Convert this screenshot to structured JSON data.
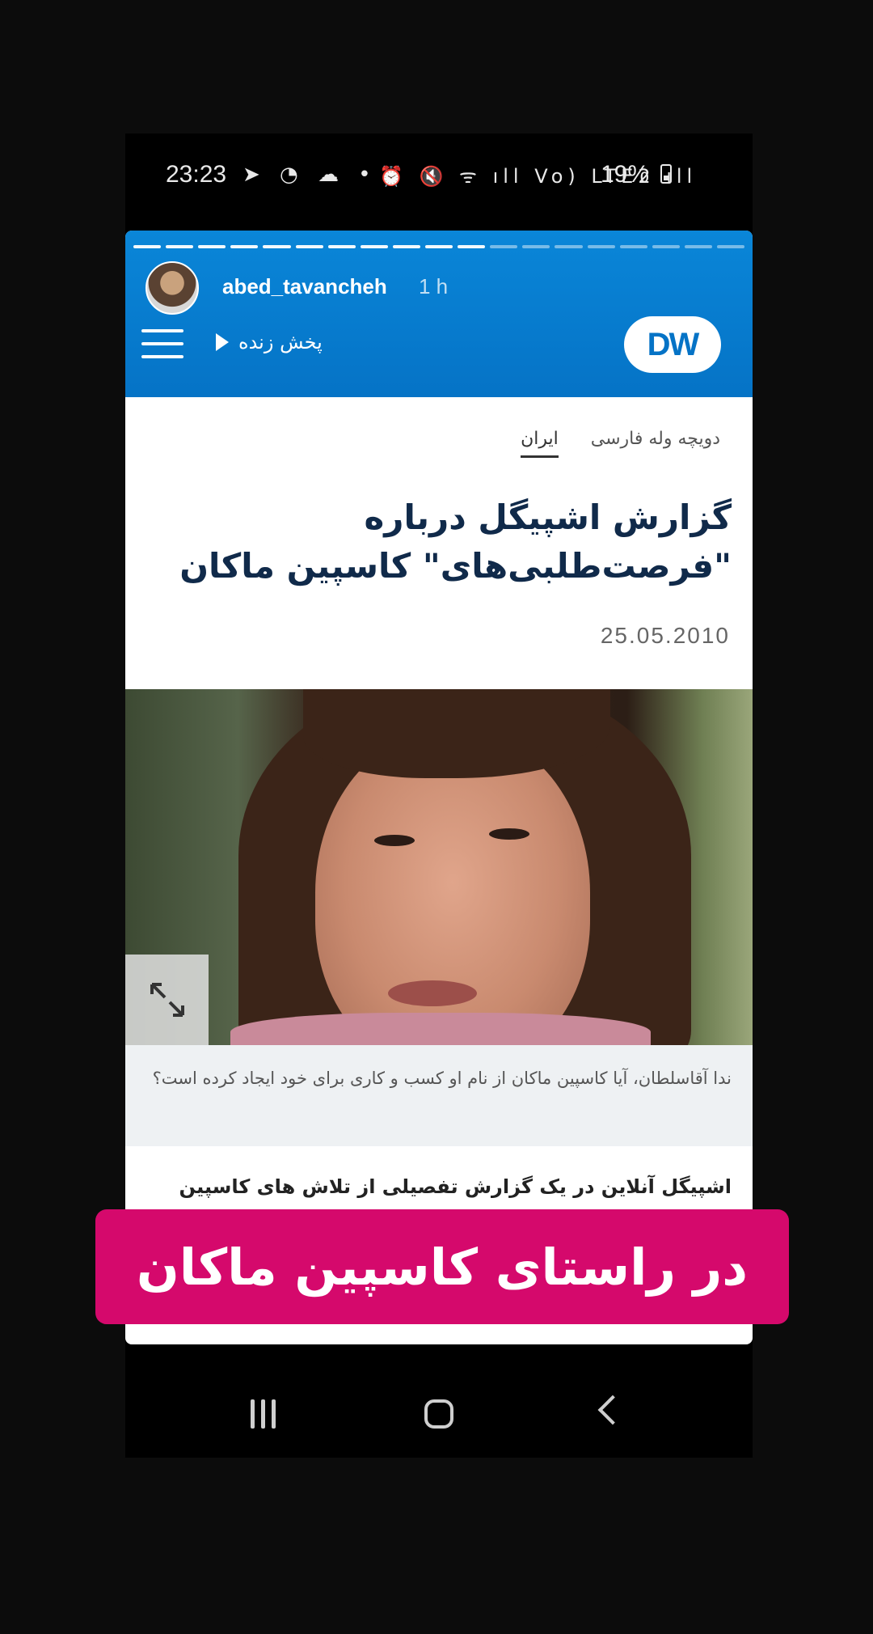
{
  "status_bar": {
    "time": "23:23",
    "left_icons": "➤ ◔ ☁ •",
    "right_icons": "⏰ 🔇 ᯤ ıll Vo) LTE2 ıll",
    "battery": "19%"
  },
  "story": {
    "username": "abed_tavancheh",
    "time_ago": "1 h",
    "progress_total": 19,
    "progress_viewed": 11
  },
  "dw": {
    "logo": "DW",
    "live_label": "پخش زنده",
    "accent": "#0573c6"
  },
  "article": {
    "breadcrumb": [
      "دویچه وله فارسی",
      "ایران"
    ],
    "title_line1": "گزارش اشپیگل درباره",
    "title_line2": "\"فرصت‌طلبی‌های\" کاسپین ماکان",
    "date": "25.05.2010",
    "caption": "ندا آقاسلطان، آیا کاسپین ماکان از نام او کسب و کاری برای خود ایجاد کرده است؟",
    "body": "اشپیگل آنلاین در یک گزارش تفصیلی از تلاش های کاسپین"
  },
  "sticker": {
    "text": "در راستای کاسپین ماکان",
    "color": "#d5096c"
  },
  "icons": {
    "menu": "hamburger-icon",
    "play": "play-icon",
    "expand": "expand-icon",
    "nav": [
      "recents-icon",
      "home-icon",
      "back-icon"
    ]
  }
}
